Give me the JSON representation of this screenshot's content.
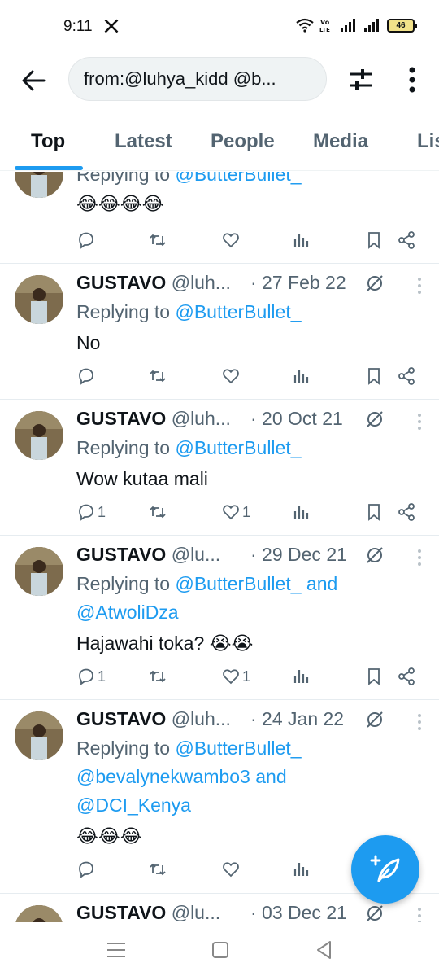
{
  "status_bar": {
    "time": "9:11",
    "battery": "46",
    "icons": [
      "x-logo-icon",
      "wifi-icon",
      "volte-icon",
      "signal-icon",
      "signal-icon",
      "battery-icon"
    ]
  },
  "header": {
    "search_value": "from:@luhya_kidd @b...",
    "icons": [
      "back-arrow-icon",
      "filter-sliders-icon",
      "more-vertical-icon"
    ]
  },
  "tabs": [
    {
      "label": "Top"
    },
    {
      "label": "Latest"
    },
    {
      "label": "People"
    },
    {
      "label": "Media"
    },
    {
      "label": "Lis"
    }
  ],
  "colors": {
    "accent": "#1d9bf0",
    "text": "#0f1419",
    "muted": "#536471"
  },
  "tweets": [
    {
      "replying": "Replying to",
      "mentions": "@ButterBullet_",
      "text": "😂😂😂😂"
    },
    {
      "name": "GUSTAVO",
      "handle": "@luh...",
      "date": "· 27 Feb 22",
      "replying": "Replying to",
      "mentions": "@ButterBullet_",
      "text": "No"
    },
    {
      "name": "GUSTAVO",
      "handle": "@luh...",
      "date": "· 20 Oct 21",
      "replying": "Replying to",
      "mentions": "@ButterBullet_",
      "text": "Wow kutaa mali",
      "reply_count": "1",
      "like_count": "1"
    },
    {
      "name": "GUSTAVO",
      "handle": "@lu...",
      "date": "· 29 Dec 21",
      "replying": "Replying to",
      "mentions_line1": "@ButterBullet_",
      "and": "and",
      "mentions_line2": "@AtwoliDza",
      "text": "Hajawahi toka? 😭😭",
      "reply_count": "1",
      "like_count": "1"
    },
    {
      "name": "GUSTAVO",
      "handle": "@luh...",
      "date": "· 24 Jan 22",
      "replying": "Replying to",
      "mentions_line1": "@ButterBullet_",
      "mentions_line2": "@bevalynekwambo3",
      "and": "and",
      "mentions_line3": "@DCI_Kenya",
      "text": "😂😂😂"
    },
    {
      "name": "GUSTAVO",
      "handle": "@lu...",
      "date": "· 03 Dec 21"
    }
  ],
  "fab": {
    "icon": "compose-post-icon"
  },
  "navbar": {
    "icons": [
      "recents-icon",
      "home-icon",
      "back-icon"
    ]
  }
}
